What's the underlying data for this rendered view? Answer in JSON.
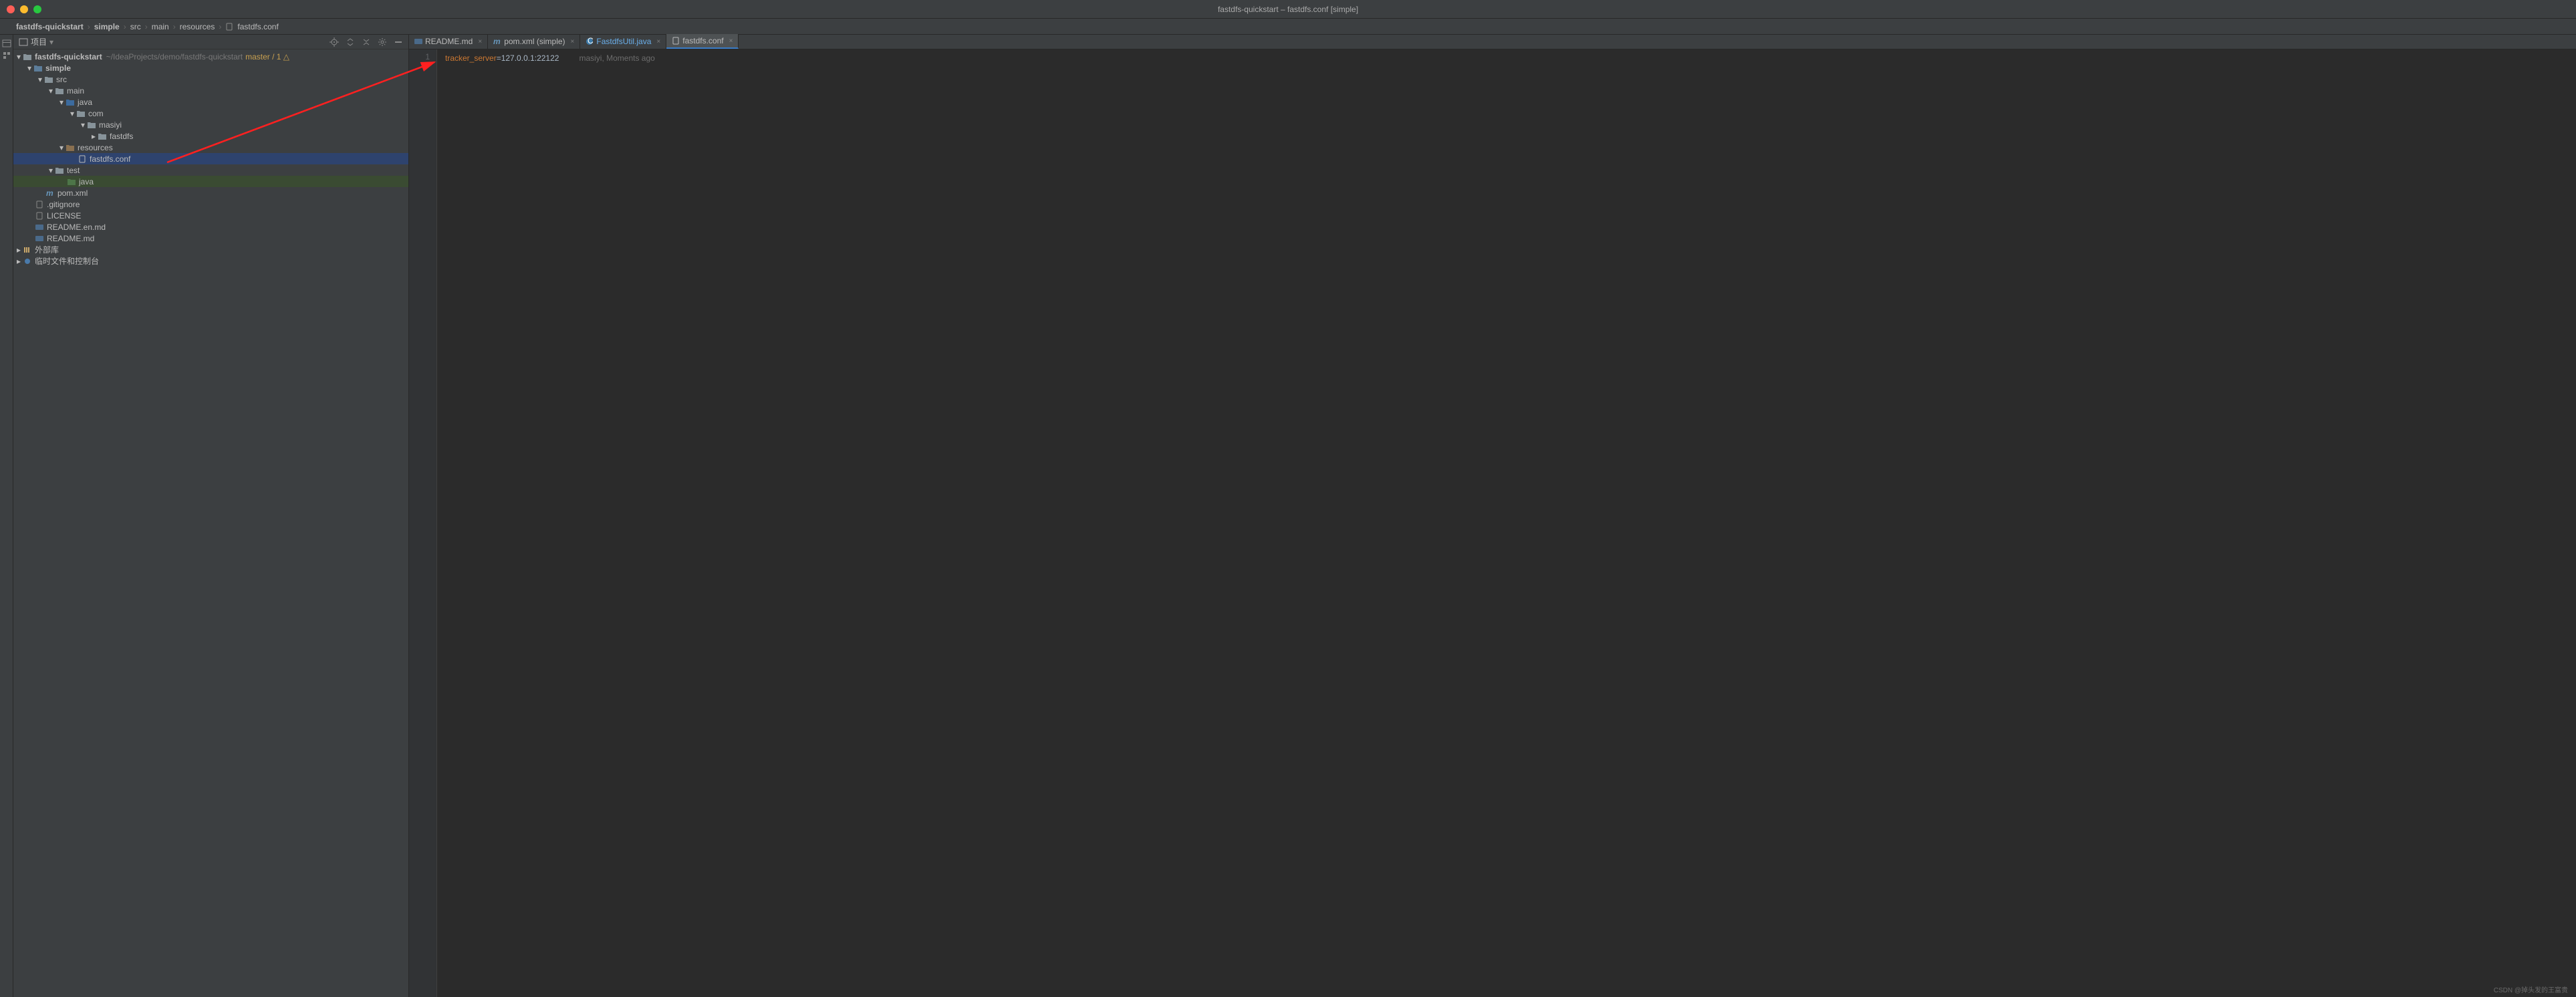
{
  "window": {
    "title": "fastdfs-quickstart – fastdfs.conf [simple]"
  },
  "breadcrumbs": {
    "items": [
      "fastdfs-quickstart",
      "simple",
      "src",
      "main",
      "resources",
      "fastdfs.conf"
    ]
  },
  "panel": {
    "title": "项目"
  },
  "tree": {
    "root": {
      "name": "fastdfs-quickstart",
      "path": "~/IdeaProjects/demo/fastdfs-quickstart",
      "vcs": "master / 1 △"
    },
    "module": "simple",
    "src": "src",
    "main": "main",
    "java": "java",
    "com": "com",
    "masiyi": "masiyi",
    "fastdfs": "fastdfs",
    "resources": "resources",
    "conf_file": "fastdfs.conf",
    "test": "test",
    "test_java": "java",
    "pom": "pom.xml",
    "gitignore": ".gitignore",
    "license": "LICENSE",
    "readme_en": "README.en.md",
    "readme": "README.md",
    "external": "外部库",
    "scratch": "临时文件和控制台"
  },
  "tabs": {
    "t1": "README.md",
    "t2": "pom.xml (simple)",
    "t3": "FastdfsUtil.java",
    "t4": "fastdfs.conf"
  },
  "code": {
    "line_no": "1",
    "key": "tracker_server",
    "eq": "=",
    "val": "127.0.0.1:22122",
    "inlay": "masiyi, Moments ago"
  },
  "watermark": "CSDN @掉头发的王富贵"
}
